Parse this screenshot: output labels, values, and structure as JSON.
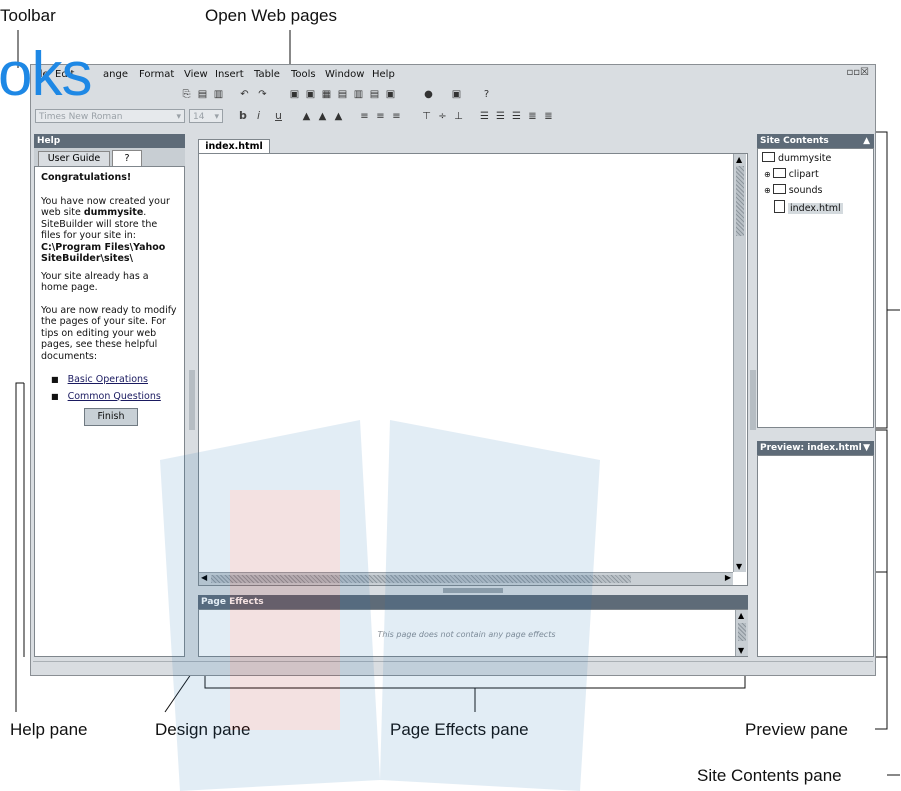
{
  "callouts": {
    "toolbar": "Toolbar",
    "open_pages": "Open Web pages",
    "help_pane": "Help pane",
    "design_pane": "Design pane",
    "page_effects_pane": "Page Effects pane",
    "preview_pane": "Preview pane",
    "site_contents_pane": "Site Contents pane"
  },
  "watermark": "oks",
  "menu": [
    "ile",
    "Edit",
    "ange",
    "Format",
    "View",
    "Insert",
    "Table",
    "Tools",
    "Window",
    "Help"
  ],
  "format_bar": {
    "font": "Times New Roman",
    "size": "14",
    "bold": "b",
    "italic": "i",
    "underline": "u"
  },
  "help": {
    "header": "Help",
    "tab_guide": "User Guide",
    "tab_help": "?",
    "title": "Congratulations!",
    "p1_a": "You have now created your web site ",
    "p1_site": "dummysite",
    "p1_b": ". SiteBuilder will store the files for your site in:",
    "path": "C:\\Program Files\\Yahoo SiteBuilder\\sites\\",
    "p2": "Your site already has a home page.",
    "p3": "You are now ready to modify the pages of your site. For tips on editing your web pages, see these helpful documents:",
    "links": [
      "Basic Operations",
      "Common Questions"
    ],
    "finish": "Finish"
  },
  "design": {
    "tab": "index.html"
  },
  "page_effects": {
    "header": "Page Effects",
    "empty": "This page does not contain any page effects"
  },
  "site_contents": {
    "header": "Site Contents",
    "root": "dummysite",
    "folders": [
      "clipart",
      "sounds"
    ],
    "file": "index.html"
  },
  "preview": {
    "header": "Preview: index.html"
  },
  "colors": {
    "pane_header": "#5e6b78",
    "watermark": "#1e88e5",
    "app_bg": "#d9dde1"
  }
}
